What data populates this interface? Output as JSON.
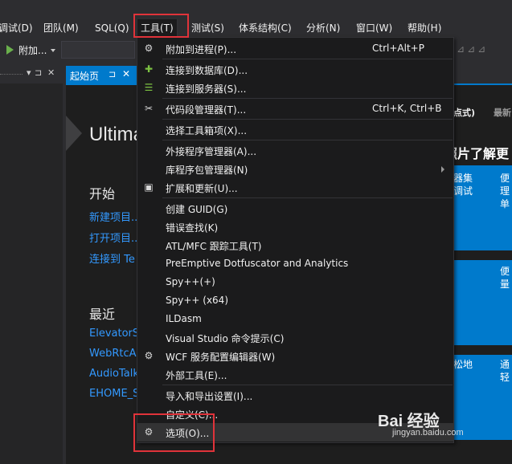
{
  "menubar": {
    "items": [
      {
        "label": "调试(D)"
      },
      {
        "label": "团队(M)"
      },
      {
        "label": "SQL(Q)"
      },
      {
        "label": "工具(T)"
      },
      {
        "label": "测试(S)"
      },
      {
        "label": "体系结构(C)"
      },
      {
        "label": "分析(N)"
      },
      {
        "label": "窗口(W)"
      },
      {
        "label": "帮助(H)"
      }
    ]
  },
  "toolbar": {
    "attach_label": "附加..."
  },
  "tab": {
    "label": "起始页",
    "pin": "⊐",
    "close": "✕"
  },
  "left_panel": {
    "pin": "⊐",
    "close": "✕"
  },
  "start_page": {
    "title": "Ultima",
    "start_heading": "开始",
    "start_links": [
      "新建项目...",
      "打开项目...",
      "连接到 Te"
    ],
    "recent_heading": "最近",
    "recent_links": [
      "ElevatorS",
      "WebRtcA",
      "AudioTalk",
      "EHOME_S"
    ],
    "right_tabs": [
      "点式)",
      "最新"
    ],
    "right_heading": "照片了解更",
    "tiles": [
      "器集\n调试",
      "便\n理\n单",
      "便\n量",
      "松地",
      "通\n轻"
    ]
  },
  "tools_menu": {
    "items": [
      {
        "label": "附加到进程(P)...",
        "shortcut": "Ctrl+Alt+P",
        "icon": "attach-process-icon"
      },
      {
        "label": "连接到数据库(D)...",
        "shortcut": "",
        "icon": "connect-database-icon"
      },
      {
        "label": "连接到服务器(S)...",
        "shortcut": "",
        "icon": "connect-server-icon"
      },
      {
        "label": "代码段管理器(T)...",
        "shortcut": "Ctrl+K, Ctrl+B",
        "icon": "code-snippet-icon"
      },
      {
        "label": "选择工具箱项(X)...",
        "shortcut": "",
        "icon": ""
      },
      {
        "label": "外接程序管理器(A)...",
        "shortcut": "",
        "icon": ""
      },
      {
        "label": "库程序包管理器(N)",
        "shortcut": "",
        "icon": ""
      },
      {
        "label": "扩展和更新(U)...",
        "shortcut": "",
        "icon": "extensions-icon"
      },
      {
        "label": "创建 GUID(G)",
        "shortcut": "",
        "icon": ""
      },
      {
        "label": "错误查找(K)",
        "shortcut": "",
        "icon": ""
      },
      {
        "label": "ATL/MFC 跟踪工具(T)",
        "shortcut": "",
        "icon": ""
      },
      {
        "label": "PreEmptive Dotfuscator and Analytics",
        "shortcut": "",
        "icon": ""
      },
      {
        "label": "Spy++(+)",
        "shortcut": "",
        "icon": ""
      },
      {
        "label": "Spy++ (x64)",
        "shortcut": "",
        "icon": ""
      },
      {
        "label": "ILDasm",
        "shortcut": "",
        "icon": ""
      },
      {
        "label": "Visual Studio 命令提示(C)",
        "shortcut": "",
        "icon": ""
      },
      {
        "label": "WCF 服务配置编辑器(W)",
        "shortcut": "",
        "icon": "wcf-config-icon"
      },
      {
        "label": "外部工具(E)...",
        "shortcut": "",
        "icon": ""
      },
      {
        "label": "导入和导出设置(I)...",
        "shortcut": "",
        "icon": ""
      },
      {
        "label": "自定义(C)...",
        "shortcut": "",
        "icon": ""
      },
      {
        "label": "选项(O)...",
        "shortcut": "",
        "icon": "gear-icon"
      }
    ]
  },
  "watermark": {
    "logo": "Bai 经验",
    "url": "jingyan.baidu.com"
  },
  "colors": {
    "accent": "#007acc",
    "highlight_box": "#e0333a",
    "menu_bg": "#1b1b1c",
    "link": "#3399ff"
  }
}
